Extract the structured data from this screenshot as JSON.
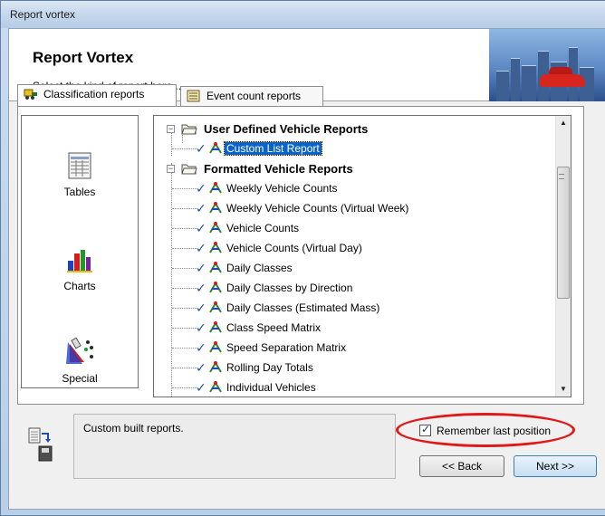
{
  "window": {
    "title": "Report vortex"
  },
  "header": {
    "title": "Report Vortex",
    "subtitle": "Select the kind of report here..."
  },
  "tabs": [
    {
      "label": "Classification reports",
      "active": true
    },
    {
      "label": "Event count reports",
      "active": false
    }
  ],
  "sidebar": {
    "items": [
      {
        "label": "Tables",
        "icon": "tables-icon"
      },
      {
        "label": "Charts",
        "icon": "charts-icon"
      },
      {
        "label": "Special",
        "icon": "special-icon"
      }
    ]
  },
  "tree": {
    "groups": [
      {
        "label": "User Defined Vehicle Reports",
        "items": [
          "Custom List Report"
        ]
      },
      {
        "label": "Formatted Vehicle Reports",
        "items": [
          "Weekly Vehicle Counts",
          "Weekly Vehicle Counts (Virtual Week)",
          "Vehicle Counts",
          "Vehicle Counts (Virtual Day)",
          "Daily Classes",
          "Daily Classes by Direction",
          "Daily Classes (Estimated Mass)",
          "Class Speed Matrix",
          "Speed Separation Matrix",
          "Rolling Day Totals",
          "Individual Vehicles"
        ]
      }
    ],
    "selected_item": "Custom List Report"
  },
  "status": {
    "text": "Custom built reports."
  },
  "options": {
    "remember_label": "Remember last position",
    "remember_checked": true
  },
  "buttons": {
    "back": "<< Back",
    "next": "Next >>"
  },
  "colors": {
    "selection": "#0a63c8",
    "check": "#1f4fa1",
    "highlight": "#e01818"
  }
}
